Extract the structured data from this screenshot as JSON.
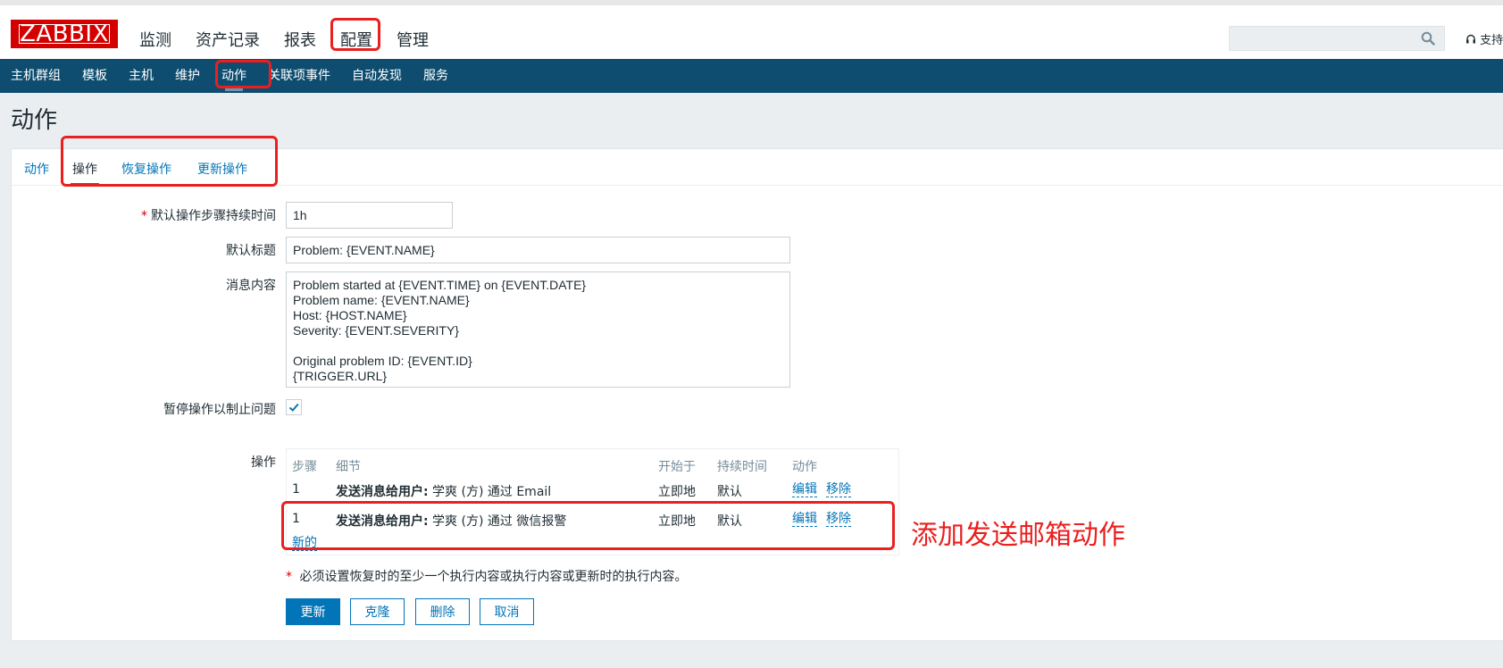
{
  "header": {
    "logo_text": "ZABBIX",
    "main_menu": [
      "监测",
      "资产记录",
      "报表",
      "配置",
      "管理"
    ],
    "support_text": "支持",
    "search_placeholder": ""
  },
  "submenu": [
    "主机群组",
    "模板",
    "主机",
    "维护",
    "动作",
    "关联项事件",
    "自动发现",
    "服务"
  ],
  "page_title": "动作",
  "tabs": [
    "动作",
    "操作",
    "恢复操作",
    "更新操作"
  ],
  "form": {
    "step_duration_label": "默认操作步骤持续时间",
    "step_duration_value": "1h",
    "subject_label": "默认标题",
    "subject_value": "Problem: {EVENT.NAME}",
    "message_label": "消息内容",
    "message_value": "Problem started at {EVENT.TIME} on {EVENT.DATE}\nProblem name: {EVENT.NAME}\nHost: {HOST.NAME}\nSeverity: {EVENT.SEVERITY}\n\nOriginal problem ID: {EVENT.ID}\n{TRIGGER.URL}",
    "pause_label": "暂停操作以制止问题",
    "pause_checked": true,
    "operations_label": "操作"
  },
  "operations": {
    "headers": [
      "步骤",
      "细节",
      "开始于",
      "持续时间",
      "动作"
    ],
    "rows": [
      {
        "step": "1",
        "detail_bold": "发送消息给用户:",
        "detail_rest": " 学爽 (方) 通过 Email",
        "start": "立即地",
        "duration": "默认",
        "edit": "编辑",
        "remove": "移除"
      },
      {
        "step": "1",
        "detail_bold": "发送消息给用户:",
        "detail_rest": " 学爽 (方) 通过 微信报警",
        "start": "立即地",
        "duration": "默认",
        "edit": "编辑",
        "remove": "移除"
      }
    ],
    "new_link": "新的"
  },
  "note": {
    "star": "*",
    "text": " 必须设置恢复时的至少一个执行内容或执行内容或更新时的执行内容。"
  },
  "buttons": {
    "update": "更新",
    "clone": "克隆",
    "delete": "删除",
    "cancel": "取消"
  },
  "annotation": "添加发送邮箱动作",
  "colors": {
    "brand_red": "#d40000",
    "nav_dark": "#0e4d6f",
    "link_blue": "#0275b8",
    "highlight_red": "#ea1f1f"
  }
}
